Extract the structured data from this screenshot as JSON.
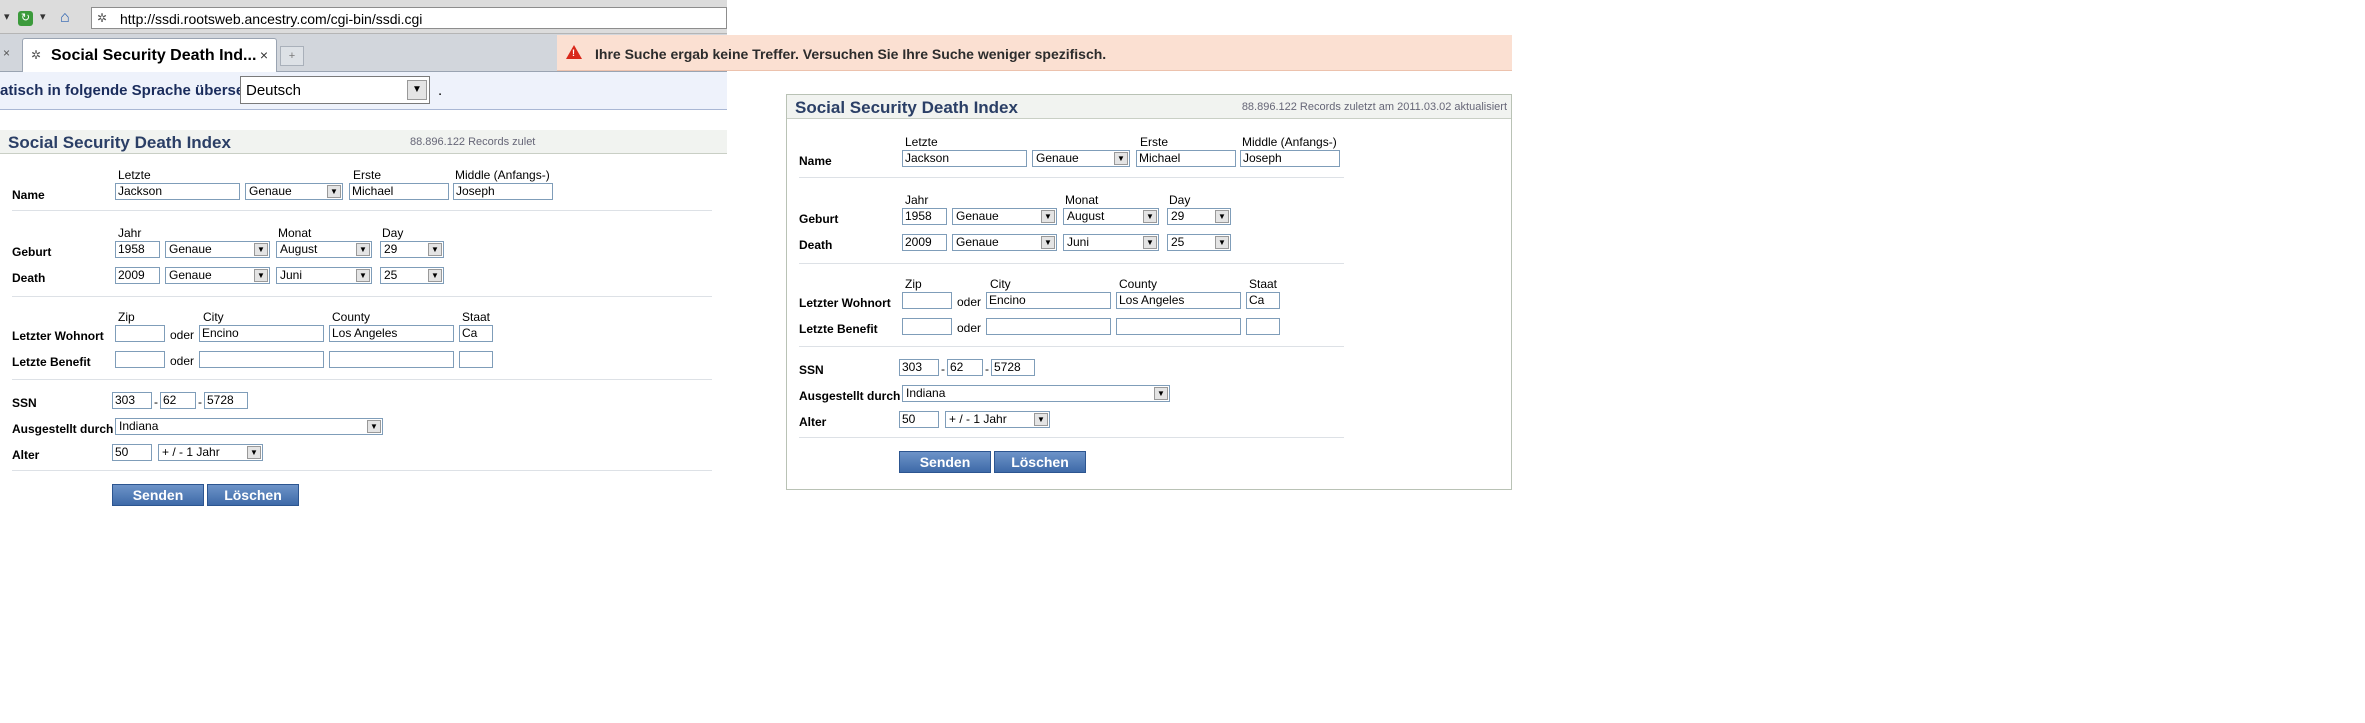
{
  "browser": {
    "url": "http://ssdi.rootsweb.ancestry.com/cgi-bin/ssdi.cgi",
    "tab_title": "Social Security Death Ind...",
    "close_glyph": "×",
    "translate_label": "atisch in folgende Sprache übersetzt:",
    "translate_language": "Deutsch",
    "translate_suffix": "."
  },
  "alert": {
    "message": "Ihre Suche ergab keine Treffer. Versuchen Sie Ihre Suche weniger spezifisch.",
    "icon": "warning-icon",
    "color": "#d9281a"
  },
  "colors": {
    "title": "#2b3f66",
    "button": "#4a77b4",
    "alert_bg": "#fbe0d2"
  },
  "form_left": {
    "title": "Social Security Death Index",
    "records_note": "88.896.122 Records zulet"
  },
  "form_right": {
    "title": "Social Security Death Index",
    "records_note": "88.896.122 Records zuletzt am 2011.03.02 aktualisiert"
  },
  "form": {
    "name_label": "Name",
    "col_last": "Letzte",
    "col_first": "Erste",
    "col_middle": "Middle (Anfangs-)",
    "last_name": "Jackson",
    "last_name_match": "Genaue",
    "first_name": "Michael",
    "middle_name": "Joseph",
    "col_year": "Jahr",
    "col_month": "Monat",
    "col_day": "Day",
    "birth_label": "Geburt",
    "birth_year": "1958",
    "birth_match": "Genaue",
    "birth_month": "August",
    "birth_day": "29",
    "death_label": "Death",
    "death_year": "2009",
    "death_match": "Genaue",
    "death_month": "Juni",
    "death_day": "25",
    "col_zip": "Zip",
    "col_city": "City",
    "col_county": "County",
    "col_state": "Staat",
    "residence_label": "Letzter Wohnort",
    "oder": "oder",
    "res_zip": "",
    "res_city": "Encino",
    "res_county": "Los Angeles",
    "res_state": "Ca",
    "benefit_label": "Letzte Benefit",
    "ben_zip": "",
    "ben_city": "",
    "ben_county": "",
    "ben_state": "",
    "ssn_label": "SSN",
    "ssn1": "303",
    "ssn2": "62",
    "ssn3": "5728",
    "dash": "-",
    "issued_label": "Ausgestellt durch",
    "issued_state": "Indiana",
    "age_label": "Alter",
    "age": "50",
    "age_range": "+ / - 1 Jahr",
    "submit": "Senden",
    "clear": "Löschen"
  }
}
